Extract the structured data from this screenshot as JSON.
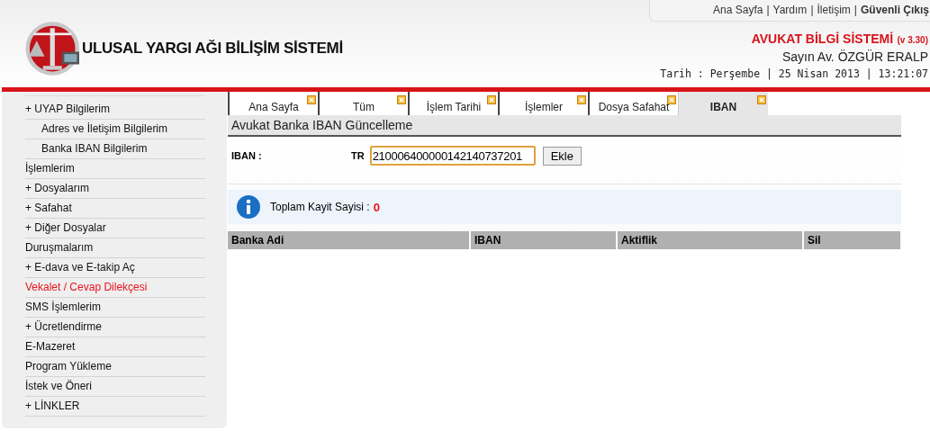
{
  "top_links": [
    {
      "kind": "link",
      "text": "Ana Sayfa"
    },
    {
      "kind": "separator",
      "text": "|"
    },
    {
      "kind": "link",
      "text": "Yardım"
    },
    {
      "kind": "separator",
      "text": "|"
    },
    {
      "kind": "link",
      "text": "İletişim"
    },
    {
      "kind": "separator",
      "text": "|"
    },
    {
      "kind": "strong",
      "text": "Güvenli Çıkış"
    }
  ],
  "logo": {
    "title": "ULUSAL YARGI AĞI BİLİŞİM SİSTEMİ"
  },
  "system": {
    "title": "AVUKAT BİLGİ SİSTEMİ",
    "version": "(v 3.30)",
    "user": "Sayın Av. ÖZGÜR ERALP",
    "date": "Tarih : Perşembe | 25 Nisan 2013 | 13:21:07"
  },
  "sidebar": {
    "items": [
      {
        "label": "+ UYAP Bilgilerim",
        "selected": false,
        "children": [
          {
            "label": "Adres ve İletişim Bilgilerim",
            "selected": false
          },
          {
            "label": "Banka IBAN Bilgilerim",
            "selected": false
          }
        ]
      },
      {
        "label": "İşlemlerim",
        "selected": false
      },
      {
        "label": "+ Dosyalarım",
        "selected": false
      },
      {
        "label": "+ Safahat",
        "selected": false
      },
      {
        "label": "+ Diğer Dosyalar",
        "selected": false
      },
      {
        "label": "Duruşmalarım",
        "selected": false
      },
      {
        "label": "+ E-dava ve E-takip Aç",
        "selected": false
      },
      {
        "label": "Vekalet / Cevap Dilekçesi",
        "selected": true
      },
      {
        "label": "SMS İşlemlerim",
        "selected": false
      },
      {
        "label": "+ Ücretlendirme",
        "selected": false
      },
      {
        "label": "E-Mazeret",
        "selected": false
      },
      {
        "label": "Program Yükleme",
        "selected": false
      },
      {
        "label": "İstek ve Öneri",
        "selected": false
      },
      {
        "label": "+ LİNKLER",
        "selected": false
      }
    ]
  },
  "tabs": [
    {
      "label": "Ana Sayfa",
      "selected": false
    },
    {
      "label": "Tüm",
      "selected": false
    },
    {
      "label": "İşlem Tarihi",
      "selected": false
    },
    {
      "label": "İşlemler",
      "selected": false
    },
    {
      "label": "Dosya Safahat",
      "selected": false
    },
    {
      "label": "IBAN",
      "selected": true
    }
  ],
  "panel": {
    "title": "Avukat Banka IBAN Güncelleme",
    "iban_label": "IBAN :",
    "prefix": "TR",
    "iban_value": "210006400000142140737201",
    "add_button": "Ekle",
    "count_label": "Toplam Kayit Sayisi :",
    "count": "0"
  },
  "table": {
    "columns": [
      "Banka Adi",
      "IBAN",
      "Aktiflik",
      "Sil"
    ]
  }
}
